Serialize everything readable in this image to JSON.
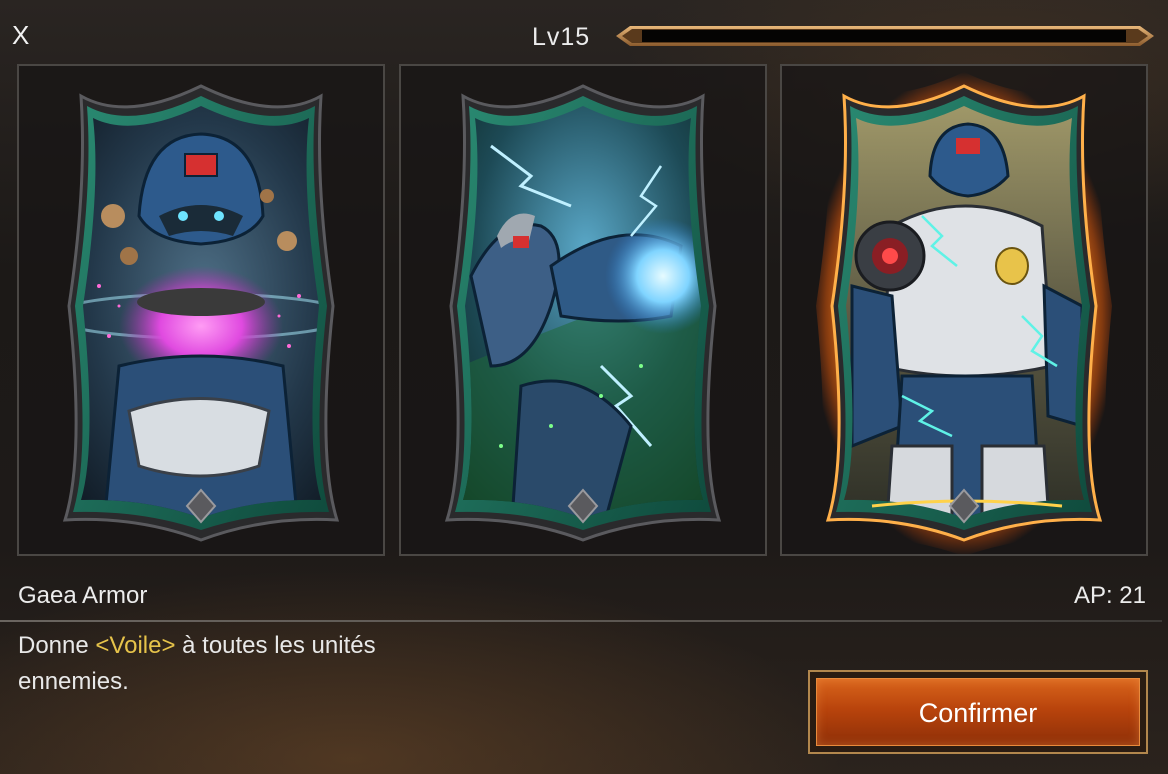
{
  "header": {
    "close_label": "X",
    "level_label": "Lv15",
    "xp_progress": 0.0
  },
  "cards": [
    {
      "id": "card-1",
      "selected": false,
      "theme": "pink-energy",
      "accent": "#e04ae0"
    },
    {
      "id": "card-2",
      "selected": false,
      "theme": "green-lightning",
      "accent": "#4fd96a"
    },
    {
      "id": "card-3",
      "selected": true,
      "theme": "gaea-armor",
      "accent": "#ff8a1e"
    }
  ],
  "chip": {
    "name": "Gaea Armor",
    "ap": "AP: 21",
    "desc_before": "Donne ",
    "desc_keyword": "<Voile>",
    "desc_after": " à toutes les unités ennemies."
  },
  "actions": {
    "confirm_label": "Confirmer"
  },
  "colors": {
    "keyword": "#e6c34a",
    "card_frame": "#1e6b5a",
    "selected_glow": "#ff8a1e",
    "confirm_button": "#c4500f"
  }
}
